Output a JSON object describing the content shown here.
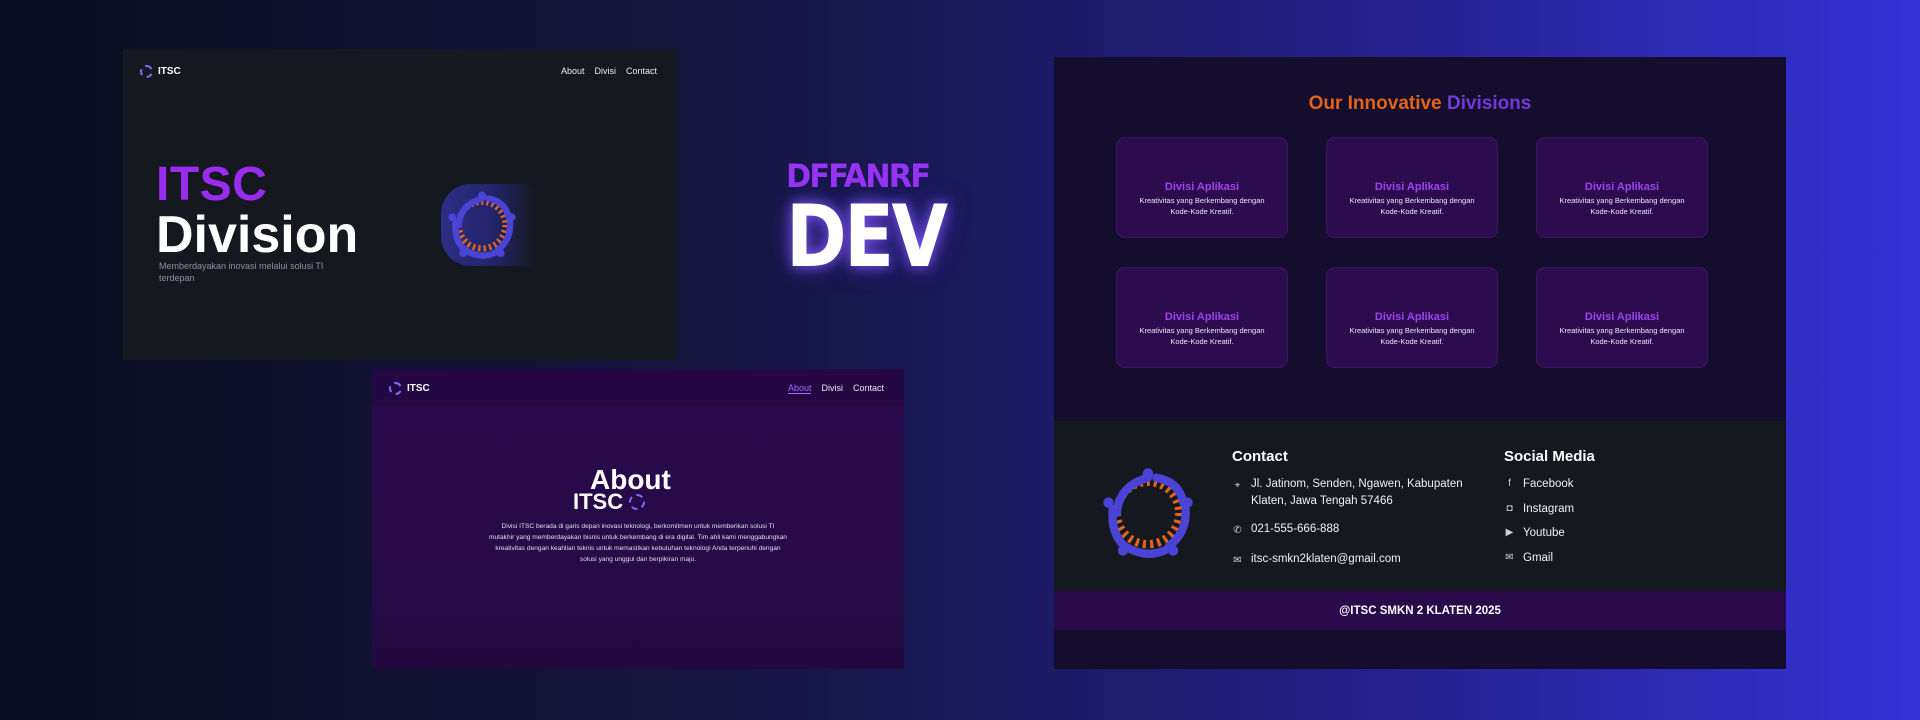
{
  "nav": {
    "brand": "ITSC",
    "links": [
      "About",
      "Divisi",
      "Contact"
    ]
  },
  "hero": {
    "title_line1": "ITSC",
    "title_line2": "Division",
    "subtitle": "Memberdayakan inovasi melalui solusi TI terdepan"
  },
  "badge": {
    "top_text": "DFFANRF",
    "main_text": "DEV"
  },
  "about": {
    "title": "About",
    "subtitle": "ITSC",
    "body": "Divisi ITSC berada di garis depan inovasi teknologi, berkomitmen untuk memberikan solusi TI mutakhir yang memberdayakan bisnis untuk berkembang di era digital. Tim ahli kami menggabungkan kreativitas dengan keahlian teknis untuk memastikan kebutuhan teknologi Anda terpenuhi dengan solusi yang unggul dan berpikiran maju."
  },
  "divisions": {
    "heading_part1": "Our Innovative",
    "heading_part2": "Divisions",
    "cards": [
      {
        "title": "Divisi Aplikasi",
        "desc": "Kreativitas yang Berkembang dengan Kode-Kode Kreatif."
      },
      {
        "title": "Divisi Aplikasi",
        "desc": "Kreativitas yang Berkembang dengan Kode-Kode Kreatif."
      },
      {
        "title": "Divisi Aplikasi",
        "desc": "Kreativitas yang Berkembang dengan Kode-Kode Kreatif."
      },
      {
        "title": "Divisi Aplikasi",
        "desc": "Kreativitas yang Berkembang dengan Kode-Kode Kreatif."
      },
      {
        "title": "Divisi Aplikasi",
        "desc": "Kreativitas yang Berkembang dengan Kode-Kode Kreatif."
      },
      {
        "title": "Divisi Aplikasi",
        "desc": "Kreativitas yang Berkembang dengan Kode-Kode Kreatif."
      }
    ]
  },
  "footer": {
    "contact_heading": "Contact",
    "address": "Jl. Jatinom, Senden, Ngawen, Kabupaten Klaten, Jawa Tengah 57466",
    "phone": "021-555-666-888",
    "email": "itsc-smkn2klaten@gmail.com",
    "social_heading": "Social Media",
    "social": [
      "Facebook",
      "Instagram",
      "Youtube",
      "Gmail"
    ],
    "copyright": "@ITSC SMKN 2 KLATEN 2025"
  },
  "colors": {
    "purple_accent": "#9a2bf0",
    "orange_accent": "#e0641b",
    "indigo_logo": "#4a44d6",
    "dark_panel": "#15191f"
  },
  "icons": {
    "logo": "itsc-logo-icon",
    "location": "map-pin-icon",
    "phone": "phone-icon",
    "mail": "mail-icon",
    "facebook": "facebook-icon",
    "instagram": "instagram-icon",
    "youtube": "youtube-icon",
    "gmail": "gmail-icon"
  }
}
